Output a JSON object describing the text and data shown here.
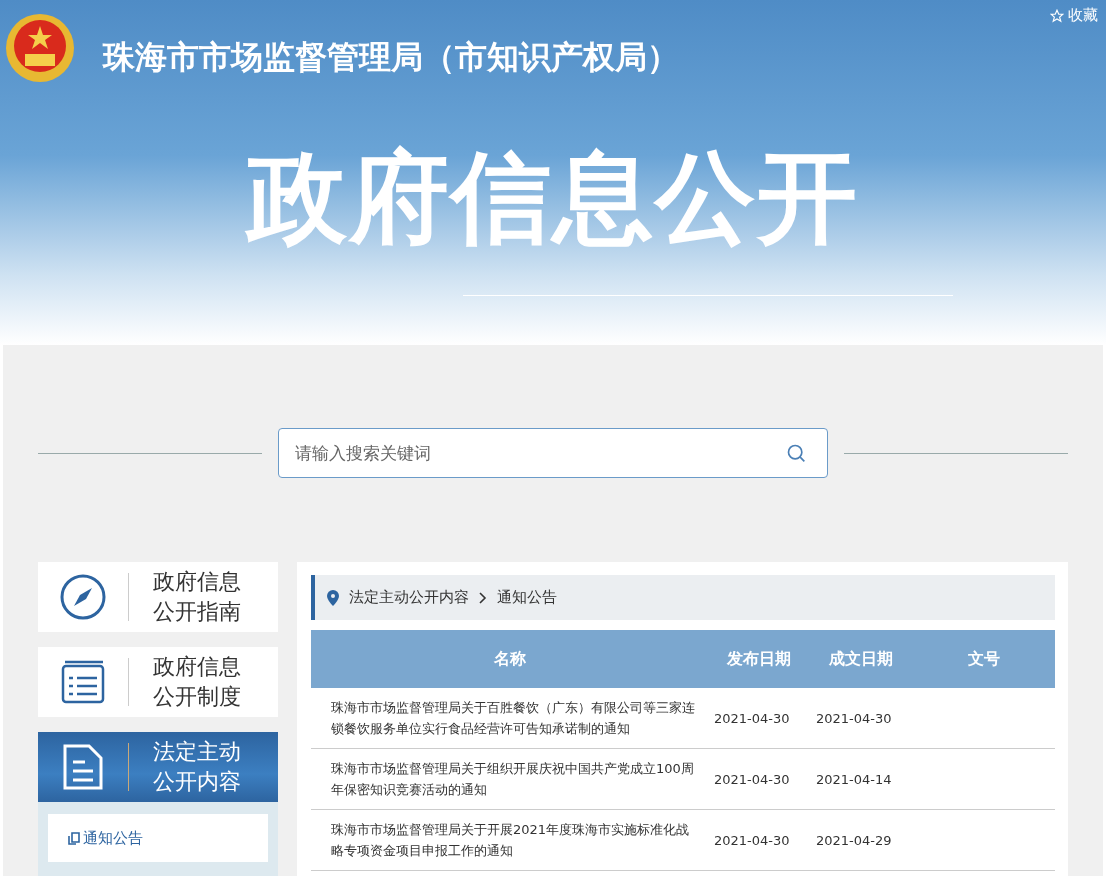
{
  "header": {
    "title": "珠海市市场监督管理局（市知识产权局）",
    "favorite": "收藏"
  },
  "banner": {
    "title": "政府信息公开"
  },
  "search": {
    "placeholder": "请输入搜索关键词"
  },
  "sidebar": {
    "items": [
      {
        "kind": "compass",
        "label": "政府信息公开指南",
        "selected": false
      },
      {
        "kind": "list",
        "label": "政府信息公开制度",
        "selected": false
      },
      {
        "kind": "document",
        "label": "法定主动公开内容",
        "selected": true,
        "children": [
          {
            "label": "通知公告"
          }
        ]
      }
    ]
  },
  "breadcrumb": [
    "法定主动公开内容",
    "通知公告"
  ],
  "table": {
    "columns": [
      "名称",
      "发布日期",
      "成文日期",
      "文号"
    ],
    "rows": [
      [
        "珠海市市场监督管理局关于百胜餐饮（广东）有限公司等三家连锁餐饮服务单位实行食品经营许可告知承诺制的通知",
        "2021-04-30",
        "2021-04-30"
      ],
      [
        "珠海市市场监督管理局关于组织开展庆祝中国共产党成立100周年保密知识竞赛活动的通知",
        "2021-04-30",
        "2021-04-14"
      ],
      [
        "珠海市市场监督管理局关于开展2021年度珠海市实施标准化战略专项资金项目申报工作的通知",
        "2021-04-30",
        "2021-04-29"
      ]
    ]
  }
}
